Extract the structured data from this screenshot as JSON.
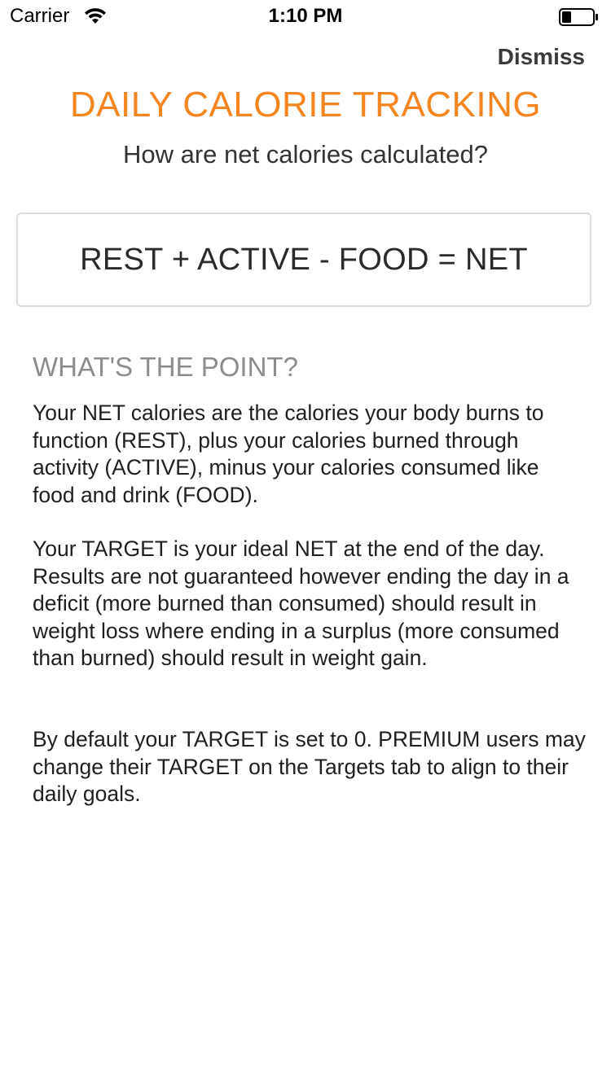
{
  "status_bar": {
    "carrier": "Carrier",
    "time": "1:10 PM",
    "icons": [
      "wifi-icon",
      "battery-icon"
    ]
  },
  "header": {
    "dismiss_label": "Dismiss"
  },
  "main": {
    "title": "DAILY CALORIE TRACKING",
    "subtitle": "How are net calories calculated?",
    "formula": "REST + ACTIVE - FOOD = NET",
    "section_heading": "WHAT'S THE POINT?",
    "paragraphs": [
      "Your NET calories are the calories your body burns to function (REST), plus your calories burned through activity (ACTIVE), minus your calories consumed like food and drink (FOOD).",
      "Your TARGET is your ideal NET at the end of the day. Results are not guaranteed however ending the day in a deficit (more burned than consumed) should result in weight loss where ending in a surplus (more consumed than burned) should result in weight gain.",
      "By default your TARGET is set to 0. PREMIUM users may change their TARGET on the Targets tab to align to their daily goals."
    ]
  },
  "colors": {
    "accent": "#f5861f",
    "heading_gray": "#8c8c8c",
    "text": "#1f1f1f",
    "border": "#dcdcdc"
  }
}
